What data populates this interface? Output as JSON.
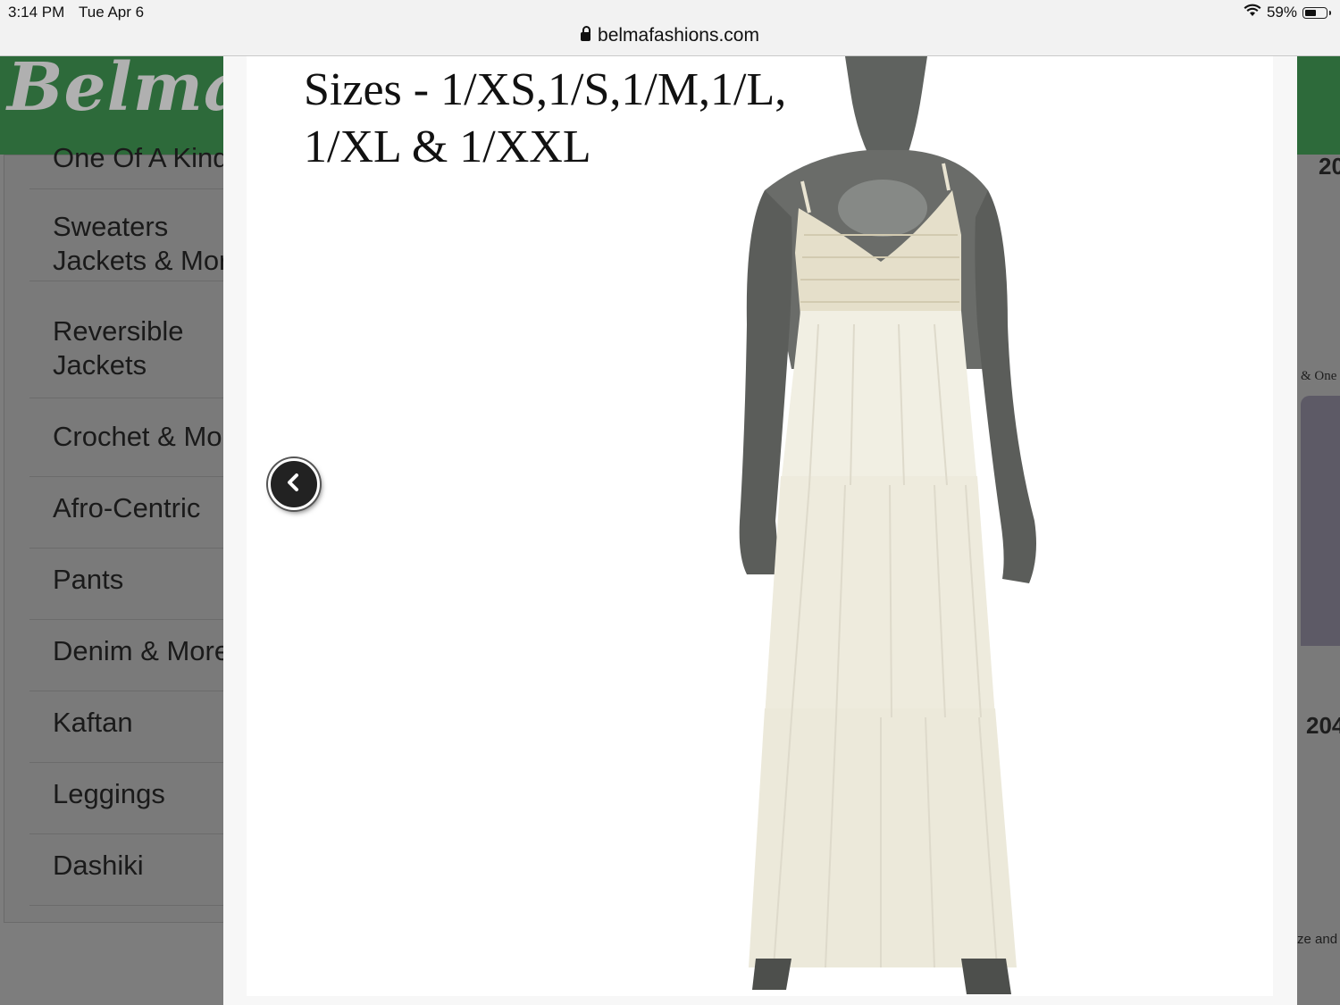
{
  "status_bar": {
    "time": "3:14 PM",
    "date": "Tue Apr 6",
    "battery_percent": "59%",
    "battery_level": 0.59
  },
  "browser": {
    "url": "belmafashions.com"
  },
  "site": {
    "logo_text": "Belma",
    "header_color": "#2d6a3a",
    "categories": [
      {
        "label": "One Of A Kind"
      },
      {
        "label": "Sweaters\nJackets & More"
      },
      {
        "label": "Reversible\nJackets"
      },
      {
        "label": "Crochet & More"
      },
      {
        "label": "Afro-Centric"
      },
      {
        "label": "Pants"
      },
      {
        "label": "Denim & More"
      },
      {
        "label": "Kaftan"
      },
      {
        "label": "Leggings"
      },
      {
        "label": "Dashiki"
      }
    ],
    "right_snippets": [
      "20",
      "& One",
      "204",
      "ze and"
    ]
  },
  "lightbox": {
    "caption": "Sizes - 1/XS,1/S,1/M,1/L,\n1/XL & 1/XXL",
    "product_image": "white-crochet-maxi-dress-on-mannequin",
    "prev_icon": "chevron-left-icon"
  }
}
